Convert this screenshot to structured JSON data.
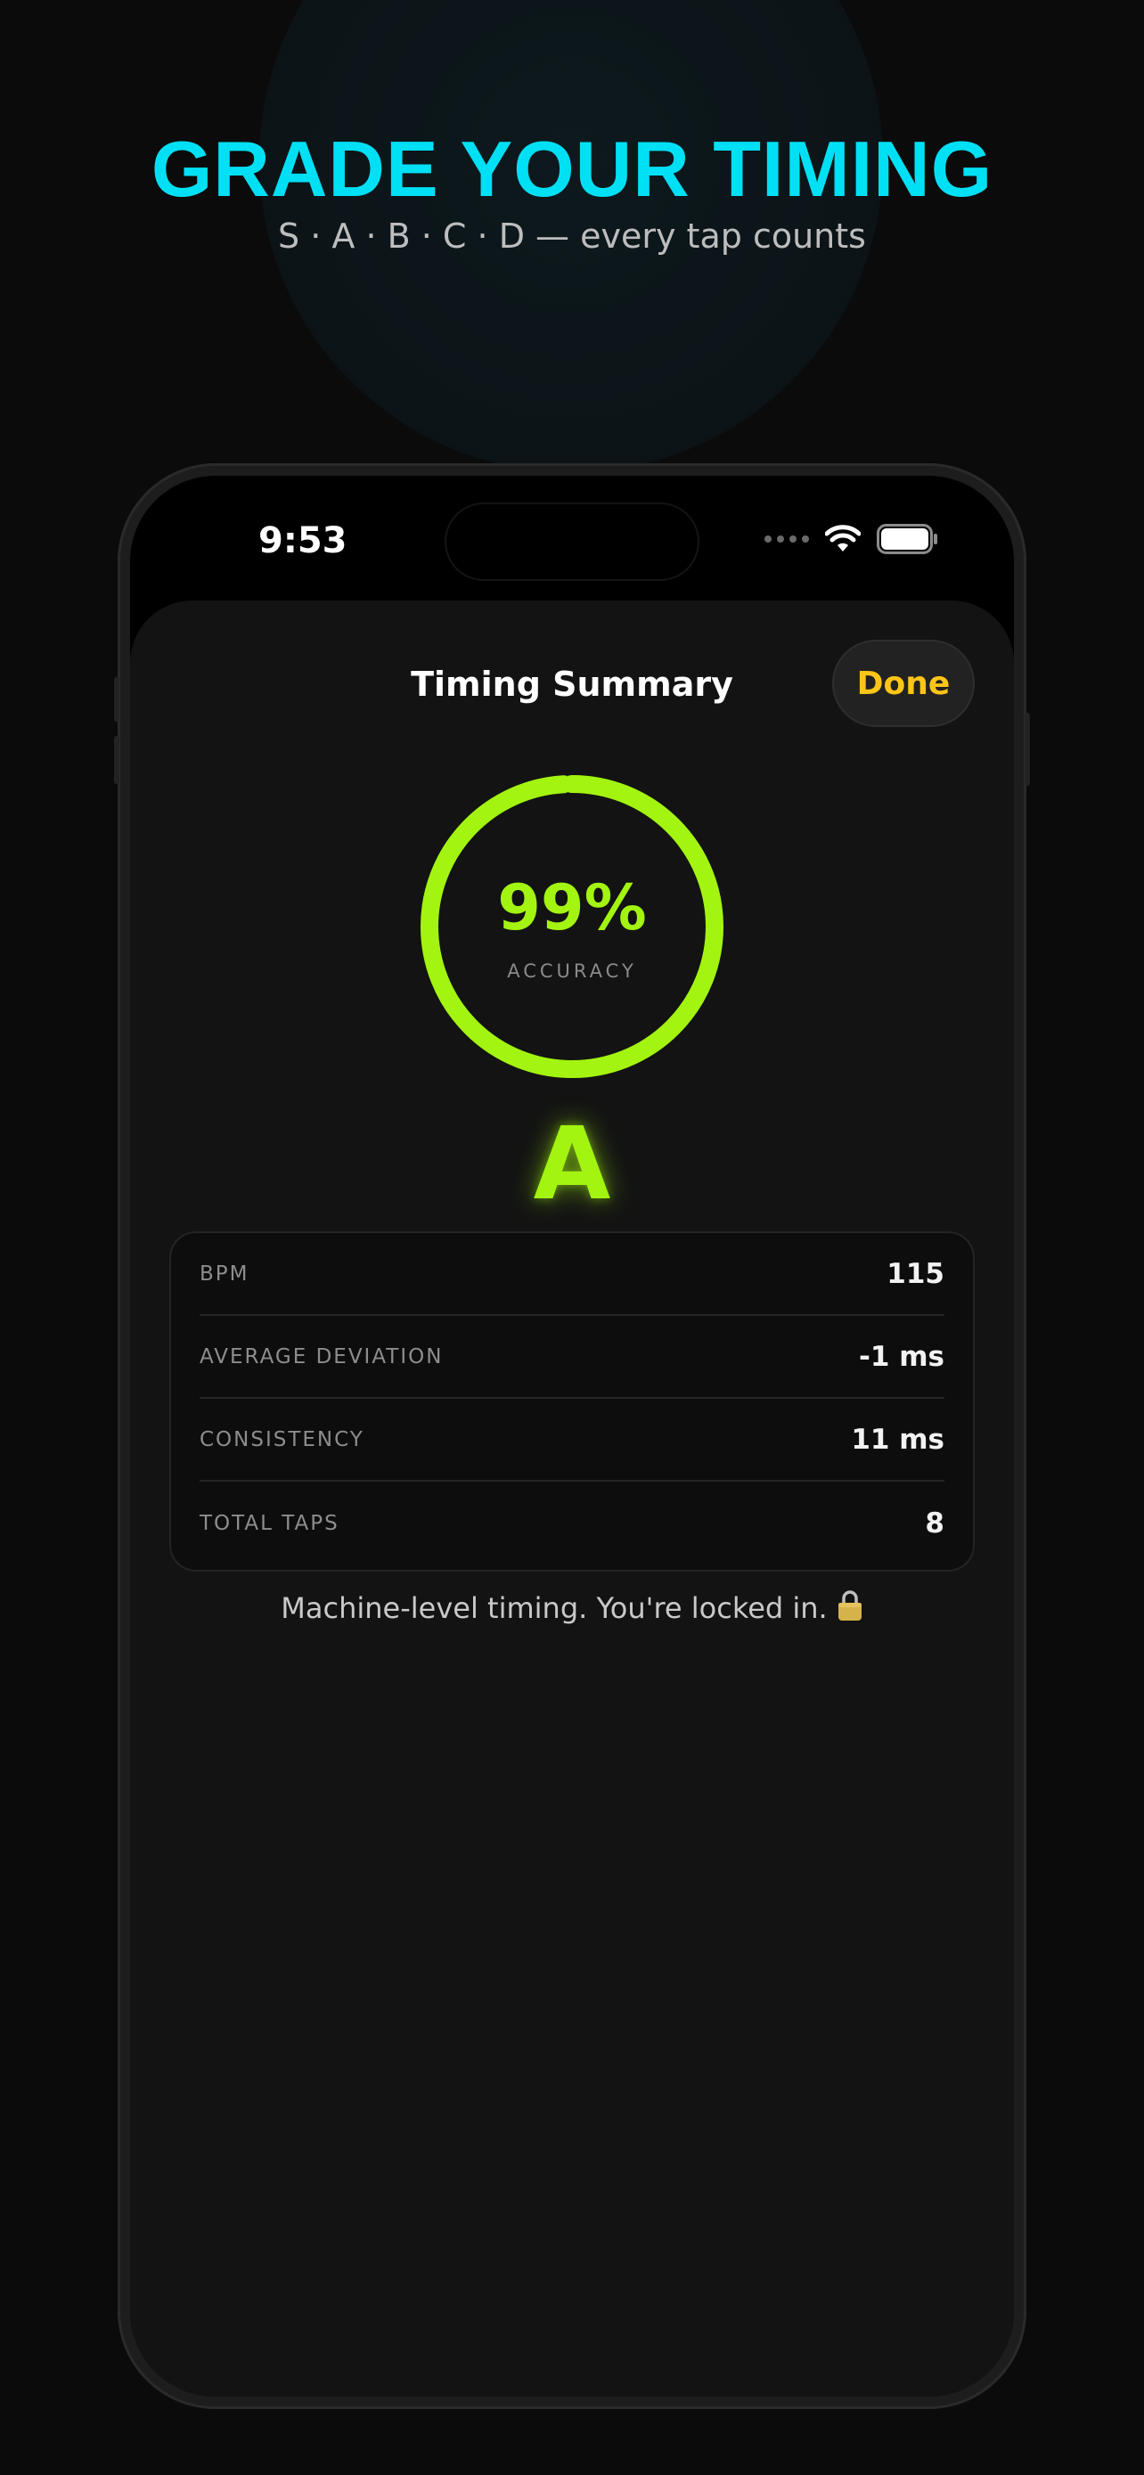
{
  "promo": {
    "headline": "GRADE YOUR TIMING",
    "subline": "S · A · B · C · D — every tap counts"
  },
  "status_bar": {
    "time": "9:53",
    "icons": [
      "cellular-signal-icon",
      "wifi-icon",
      "battery-icon"
    ]
  },
  "sheet": {
    "title": "Timing Summary",
    "done_label": "Done"
  },
  "accuracy": {
    "value": "99%",
    "label": "ACCURACY",
    "fraction": 0.99
  },
  "grade": "A",
  "stats": [
    {
      "label": "BPM",
      "value": "115"
    },
    {
      "label": "AVERAGE DEVIATION",
      "value": "-1 ms"
    },
    {
      "label": "CONSISTENCY",
      "value": "11 ms"
    },
    {
      "label": "TOTAL TAPS",
      "value": "8"
    }
  ],
  "footer_message": "Machine-level timing. You're locked in.",
  "footer_icon": "lock-icon",
  "colors": {
    "headline": "#00e0f5",
    "accent": "#a3f410",
    "done": "#ffc518",
    "background": "#0b0b0b",
    "sheet": "#131313"
  }
}
